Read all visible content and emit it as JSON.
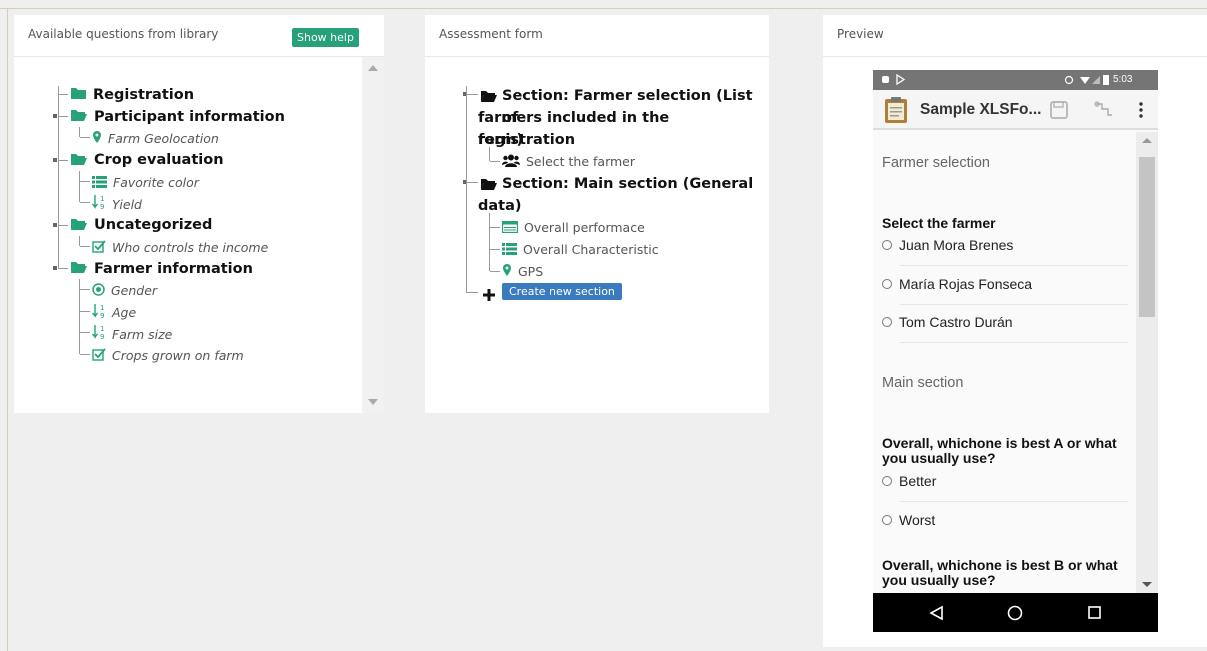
{
  "library": {
    "header": "Available questions from library",
    "help_label": "Show help",
    "folders": [
      {
        "label": "Registration",
        "icon": "folder-icon",
        "items": []
      },
      {
        "label": "Participant information",
        "icon": "folder-open-icon",
        "items": [
          {
            "label": "Farm Geolocation",
            "icon": "map-marker-icon"
          }
        ]
      },
      {
        "label": "Crop evaluation",
        "icon": "folder-open-icon",
        "items": [
          {
            "label": "Favorite color",
            "icon": "list-icon"
          },
          {
            "label": "Yield",
            "icon": "numeric-sort-icon"
          }
        ]
      },
      {
        "label": "Uncategorized",
        "icon": "folder-open-icon",
        "items": [
          {
            "label": "Who controls the income",
            "icon": "checkbox-icon"
          }
        ]
      },
      {
        "label": "Farmer information",
        "icon": "folder-open-icon",
        "items": [
          {
            "label": "Gender",
            "icon": "radio-icon"
          },
          {
            "label": "Age",
            "icon": "numeric-sort-icon"
          },
          {
            "label": "Farm size",
            "icon": "numeric-sort-icon"
          },
          {
            "label": "Crops grown on farm",
            "icon": "checkbox-icon"
          }
        ]
      }
    ]
  },
  "form": {
    "header": "Assessment form",
    "sections": [
      {
        "label_lines": [
          "Section: Farmer selection (List of",
          "farmers included in the registration",
          "form)"
        ],
        "items": [
          {
            "label": "Select the farmer",
            "icon": "users-icon"
          }
        ]
      },
      {
        "label_lines": [
          "Section: Main section (General",
          "data)"
        ],
        "items": [
          {
            "label": "Overall performace",
            "icon": "table-icon"
          },
          {
            "label": "Overall Characteristic",
            "icon": "list-icon"
          },
          {
            "label": "GPS",
            "icon": "map-marker-icon"
          }
        ]
      }
    ],
    "create_label": "Create new section"
  },
  "preview": {
    "header": "Preview",
    "phone": {
      "time": "5:03",
      "app_title": "Sample XLSFo...",
      "sections": [
        {
          "title": "Farmer selection",
          "question": "Select the farmer",
          "options": [
            "Juan Mora Brenes",
            "María Rojas Fonseca",
            "Tom Castro Durán"
          ]
        },
        {
          "title": "Main section",
          "question": "Overall, whichone is best A or what you usually use?",
          "options": [
            "Better",
            "Worst"
          ]
        }
      ],
      "question_b": "Overall, whichone is best B or what you usually use?"
    }
  },
  "colors": {
    "accent_green": "#26a17b",
    "button_blue": "#3a7bc0",
    "status_gray": "#757575"
  }
}
